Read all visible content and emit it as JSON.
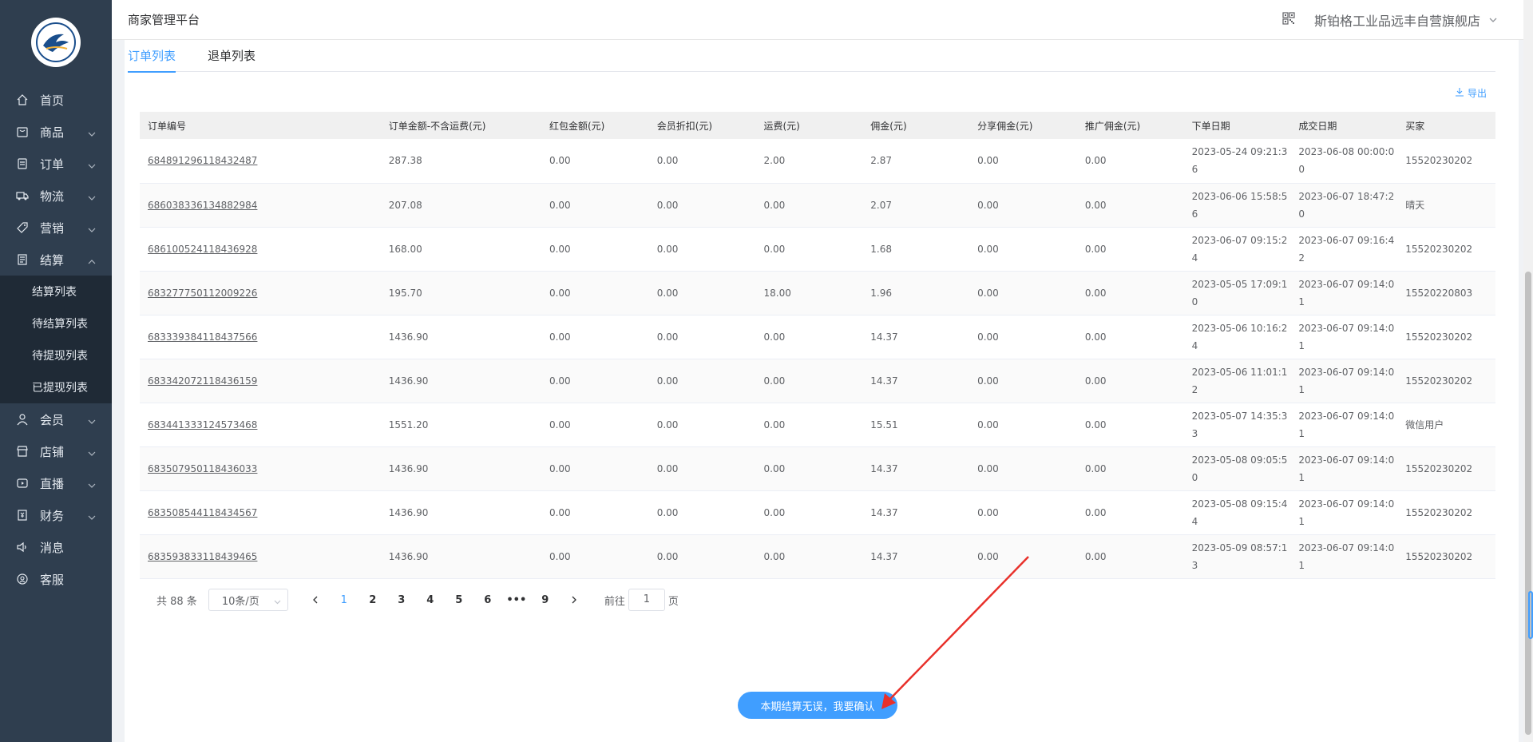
{
  "app": {
    "title": "商家管理平台",
    "shop_name": "斯铂格工业品远丰自营旗舰店"
  },
  "sidebar": {
    "items": [
      {
        "label": "首页",
        "icon": "home-icon",
        "expandable": false
      },
      {
        "label": "商品",
        "icon": "goods-icon",
        "expandable": true
      },
      {
        "label": "订单",
        "icon": "order-icon",
        "expandable": true
      },
      {
        "label": "物流",
        "icon": "truck-icon",
        "expandable": true
      },
      {
        "label": "营销",
        "icon": "tag-icon",
        "expandable": true
      },
      {
        "label": "结算",
        "icon": "settlement-icon",
        "expandable": true,
        "expanded": true
      },
      {
        "label": "会员",
        "icon": "user-icon",
        "expandable": true
      },
      {
        "label": "店铺",
        "icon": "store-icon",
        "expandable": true
      },
      {
        "label": "直播",
        "icon": "live-icon",
        "expandable": true
      },
      {
        "label": "财务",
        "icon": "finance-icon",
        "expandable": true
      },
      {
        "label": "消息",
        "icon": "message-icon",
        "expandable": false
      },
      {
        "label": "客服",
        "icon": "service-icon",
        "expandable": false
      }
    ],
    "settlement_sub": [
      "结算列表",
      "待结算列表",
      "待提现列表",
      "已提现列表"
    ]
  },
  "tabs": [
    "订单列表",
    "退单列表"
  ],
  "export_label": "导出",
  "table": {
    "headers": [
      "订单编号",
      "订单金额-不含运费(元)",
      "红包金额(元)",
      "会员折扣(元)",
      "运费(元)",
      "佣金(元)",
      "分享佣金(元)",
      "推广佣金(元)",
      "下单日期",
      "成交日期",
      "买家"
    ],
    "rows": [
      [
        "684891296118432487",
        "287.38",
        "0.00",
        "0.00",
        "2.00",
        "2.87",
        "0.00",
        "0.00",
        "2023-05-24 09:21:36",
        "2023-06-08 00:00:00",
        "15520230202"
      ],
      [
        "686038336134882984",
        "207.08",
        "0.00",
        "0.00",
        "0.00",
        "2.07",
        "0.00",
        "0.00",
        "2023-06-06 15:58:56",
        "2023-06-07 18:47:20",
        "晴天"
      ],
      [
        "686100524118436928",
        "168.00",
        "0.00",
        "0.00",
        "0.00",
        "1.68",
        "0.00",
        "0.00",
        "2023-06-07 09:15:24",
        "2023-06-07 09:16:42",
        "15520230202"
      ],
      [
        "683277750112009226",
        "195.70",
        "0.00",
        "0.00",
        "18.00",
        "1.96",
        "0.00",
        "0.00",
        "2023-05-05 17:09:10",
        "2023-06-07 09:14:01",
        "15520220803"
      ],
      [
        "683339384118437566",
        "1436.90",
        "0.00",
        "0.00",
        "0.00",
        "14.37",
        "0.00",
        "0.00",
        "2023-05-06 10:16:24",
        "2023-06-07 09:14:01",
        "15520230202"
      ],
      [
        "683342072118436159",
        "1436.90",
        "0.00",
        "0.00",
        "0.00",
        "14.37",
        "0.00",
        "0.00",
        "2023-05-06 11:01:12",
        "2023-06-07 09:14:01",
        "15520230202"
      ],
      [
        "683441333124573468",
        "1551.20",
        "0.00",
        "0.00",
        "0.00",
        "15.51",
        "0.00",
        "0.00",
        "2023-05-07 14:35:33",
        "2023-06-07 09:14:01",
        "微信用户"
      ],
      [
        "683507950118436033",
        "1436.90",
        "0.00",
        "0.00",
        "0.00",
        "14.37",
        "0.00",
        "0.00",
        "2023-05-08 09:05:50",
        "2023-06-07 09:14:01",
        "15520230202"
      ],
      [
        "683508544118434567",
        "1436.90",
        "0.00",
        "0.00",
        "0.00",
        "14.37",
        "0.00",
        "0.00",
        "2023-05-08 09:15:44",
        "2023-06-07 09:14:01",
        "15520230202"
      ],
      [
        "683593833118439465",
        "1436.90",
        "0.00",
        "0.00",
        "0.00",
        "14.37",
        "0.00",
        "0.00",
        "2023-05-09 08:57:13",
        "2023-06-07 09:14:01",
        "15520230202"
      ]
    ]
  },
  "pagination": {
    "total_text": "共 88 条",
    "page_size": "10条/页",
    "pages": [
      "1",
      "2",
      "3",
      "4",
      "5",
      "6",
      "•••",
      "9"
    ],
    "current": "1",
    "goto_prefix": "前往",
    "goto_value": "1",
    "goto_suffix": "页"
  },
  "confirm_button": "本期结算无误，我要确认",
  "colors": {
    "sidebar_bg": "#2f3e4f",
    "accent": "#409eff",
    "annotation_arrow": "#e8302a"
  }
}
